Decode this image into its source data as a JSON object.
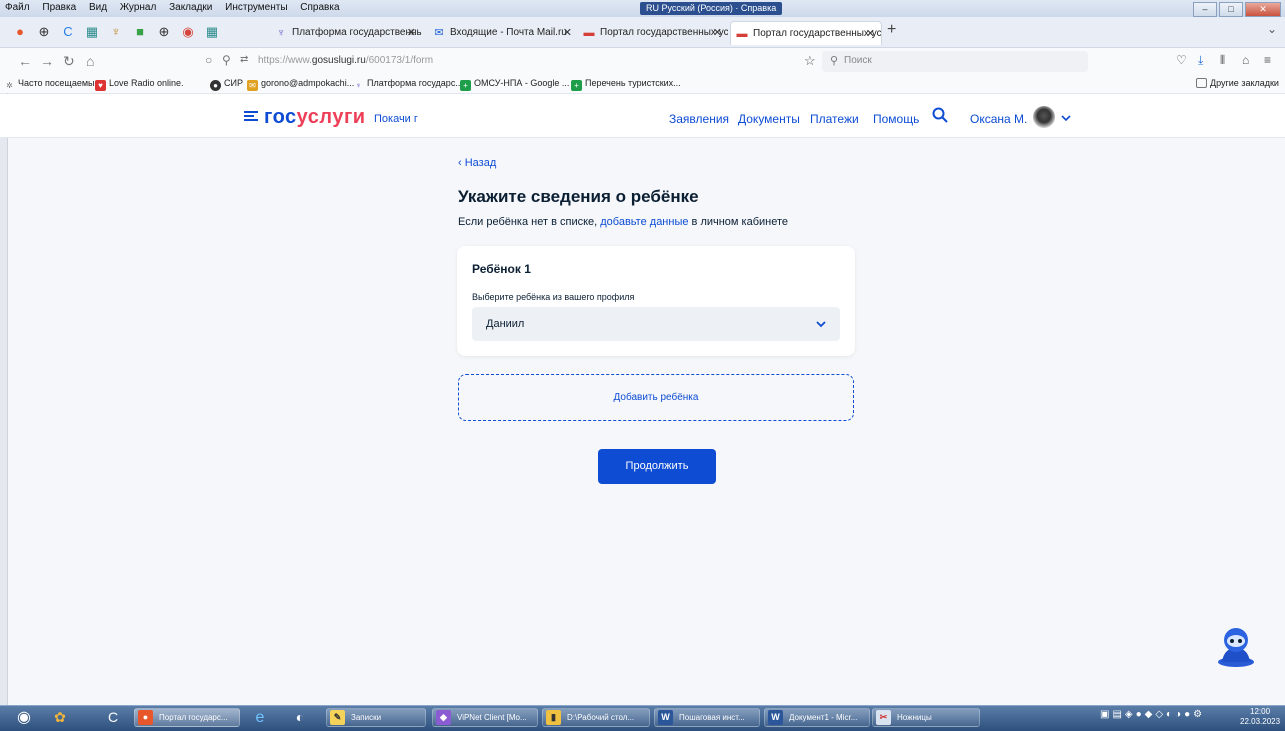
{
  "menubar": {
    "items": [
      "Файл",
      "Правка",
      "Вид",
      "Журнал",
      "Закладки",
      "Инструменты",
      "Справка"
    ],
    "ime": "RU Русский (Россия)",
    "help": "Справка"
  },
  "tabs": [
    {
      "title": "Платформа государственны",
      "icon": "shield-icon"
    },
    {
      "title": "Входящие - Почта Mail.ru",
      "icon": "mail-icon"
    },
    {
      "title": "Портал государственных услу",
      "icon": "flag-icon"
    },
    {
      "title": "Портал государственных услу",
      "icon": "flag-icon",
      "active": true
    }
  ],
  "navbar": {
    "url_prefix": "https://www.",
    "url_domain": "gosuslugi.ru",
    "url_path": "/600173/1/form",
    "search_placeholder": "Поиск"
  },
  "bookmarks": [
    "Часто посещаемые",
    "Love Radio online.",
    "СИР",
    "gorono@admpokachi...",
    "Платформа государс...",
    "ОМСУ-НПА - Google ...",
    "Перечень туристских..."
  ],
  "bookmarks_other": "Другие закладки",
  "header": {
    "logo_a": "гос",
    "logo_b": "услуги",
    "city": "Покачи г",
    "nav": [
      "Заявления",
      "Документы",
      "Платежи",
      "Помощь"
    ],
    "user": "Оксана М."
  },
  "form": {
    "back": "Назад",
    "title": "Укажите сведения о ребёнке",
    "subtitle_pre": "Если ребёнка нет в списке, ",
    "subtitle_link": "добавьте данные",
    "subtitle_post": " в личном кабинете",
    "card_title": "Ребёнок 1",
    "select_label": "Выберите ребёнка из вашего профиля",
    "select_value": "Даниил",
    "add_child": "Добавить ребёнка",
    "continue": "Продолжить"
  },
  "taskbar": {
    "items": [
      "Портал государс...",
      "Записки",
      "ViPNet Client [Mo...",
      "D:\\Рабочий стол...",
      "Пошаговая инст...",
      "Документ1 - Micr...",
      "Ножницы"
    ],
    "time": "12:00",
    "date": "22.03.2023"
  },
  "colors": {
    "brand_blue": "#0d4cd3",
    "brand_red": "#ee3f58",
    "page_bg": "#f5f7fb"
  }
}
